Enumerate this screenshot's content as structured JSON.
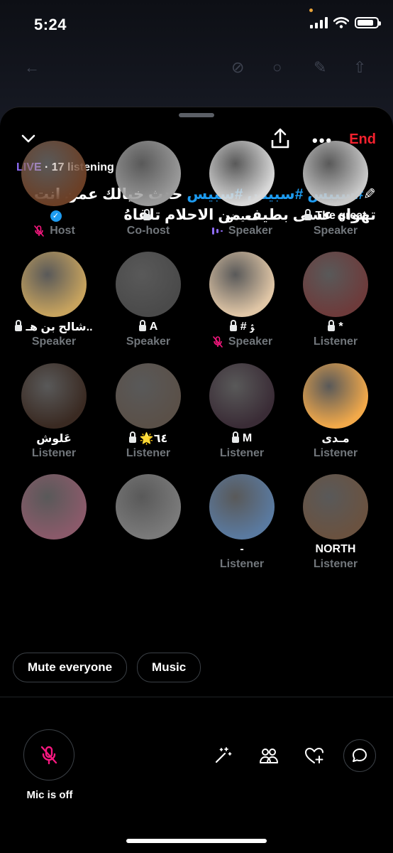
{
  "status_bar": {
    "time": "5:24"
  },
  "space": {
    "end_label": "End",
    "live_label": "LIVE",
    "listening_text": " · 17 listening",
    "title_hashtags": "#سبيس #سبيس #سبيس",
    "title_text": " حدث خيالك عمن انت تهواه عسى بطيف من الاحلام تلقاهُ"
  },
  "participants": [
    {
      "name": "",
      "role": "Host",
      "verified": true,
      "lock": false,
      "muted": true,
      "speaking": false,
      "color": "#6b3f26"
    },
    {
      "name": "",
      "role": "Co-host",
      "verified": false,
      "lock": true,
      "muted": false,
      "speaking": false,
      "color": "#9a9a9a"
    },
    {
      "name": "معيض",
      "role": "Speaker",
      "verified": false,
      "lock": false,
      "muted": false,
      "speaking": true,
      "color": "#d8d8d8"
    },
    {
      "name": "The great",
      "role": "Speaker",
      "verified": false,
      "lock": true,
      "muted": false,
      "speaking": false,
      "color": "#c9c9c9"
    },
    {
      "name": "شالح بن هـ..",
      "role": "Speaker",
      "verified": false,
      "lock": true,
      "muted": false,
      "speaking": false,
      "color": "#c7a35e"
    },
    {
      "name": "A",
      "role": "Speaker",
      "verified": false,
      "lock": true,
      "muted": false,
      "speaking": false,
      "color": "#4a4a4a"
    },
    {
      "name": "# ﯣ",
      "role": "Speaker",
      "verified": false,
      "lock": true,
      "muted": true,
      "speaking": false,
      "color": "#e0c6a6"
    },
    {
      "name": "*",
      "role": "Listener",
      "verified": false,
      "lock": true,
      "muted": false,
      "speaking": false,
      "color": "#6d3b3b"
    },
    {
      "name": "عَلوش",
      "role": "Listener",
      "verified": false,
      "lock": false,
      "muted": false,
      "speaking": false,
      "color": "#3a2a22"
    },
    {
      "name": "🌟٦٤",
      "role": "Listener",
      "verified": false,
      "lock": true,
      "muted": false,
      "speaking": false,
      "color": "#5a5048"
    },
    {
      "name": "M",
      "role": "Listener",
      "verified": false,
      "lock": true,
      "muted": false,
      "speaking": false,
      "color": "#3a2c36"
    },
    {
      "name": "مـدى",
      "role": "Listener",
      "verified": false,
      "lock": false,
      "muted": false,
      "speaking": false,
      "color": "#f2a94a"
    },
    {
      "name": "",
      "role": "",
      "verified": false,
      "lock": false,
      "muted": false,
      "speaking": false,
      "color": "#8a5a6a"
    },
    {
      "name": "",
      "role": "",
      "verified": false,
      "lock": false,
      "muted": false,
      "speaking": false,
      "color": "#7a7a7a"
    },
    {
      "name": "-",
      "role": "Listener",
      "verified": false,
      "lock": false,
      "muted": false,
      "speaking": false,
      "color": "#5a7aa0"
    },
    {
      "name": "NORTH",
      "role": "Listener",
      "verified": false,
      "lock": false,
      "muted": false,
      "speaking": false,
      "color": "#6a5240"
    }
  ],
  "controls": {
    "mute_everyone": "Mute everyone",
    "music": "Music",
    "mic_status": "Mic is off"
  }
}
